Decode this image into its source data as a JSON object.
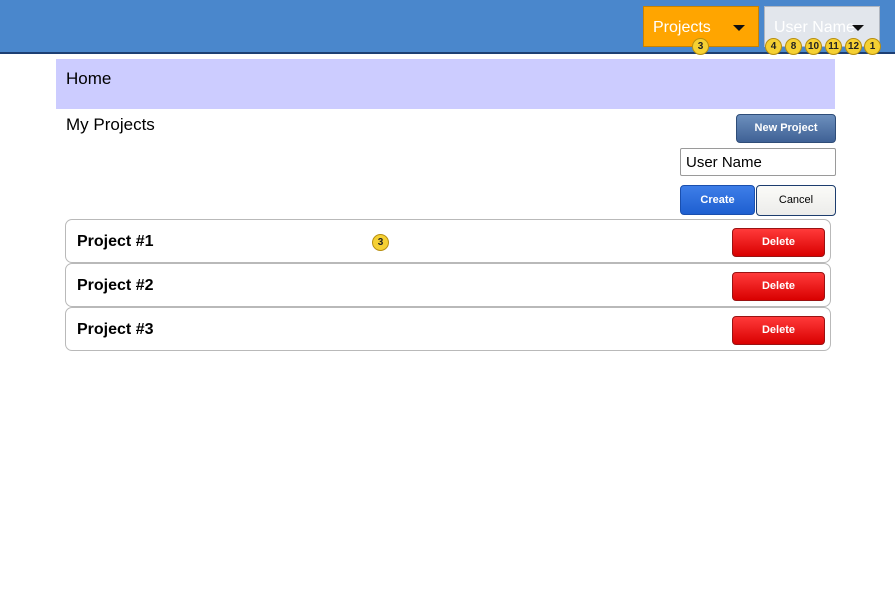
{
  "header": {
    "projects_label": "Projects",
    "user_label": "User Name",
    "projects_badge": "3",
    "user_badges": [
      "4",
      "8",
      "10",
      "11",
      "12",
      "1"
    ]
  },
  "home": {
    "title": "Home"
  },
  "projects": {
    "section_title": "My Projects",
    "new_button": "New Project",
    "name_input_value": "User Name",
    "create_button": "Create",
    "cancel_button": "Cancel",
    "row_badge": "3",
    "items": [
      {
        "title": "Project #1",
        "delete_label": "Delete"
      },
      {
        "title": "Project #2",
        "delete_label": "Delete"
      },
      {
        "title": "Project #3",
        "delete_label": "Delete"
      }
    ]
  },
  "colors": {
    "topbar": "#4a87cc",
    "projects_dropdown": "#ffa500",
    "home_band": "#ccccff",
    "delete": "#e00000",
    "create": "#2a6fe0"
  }
}
